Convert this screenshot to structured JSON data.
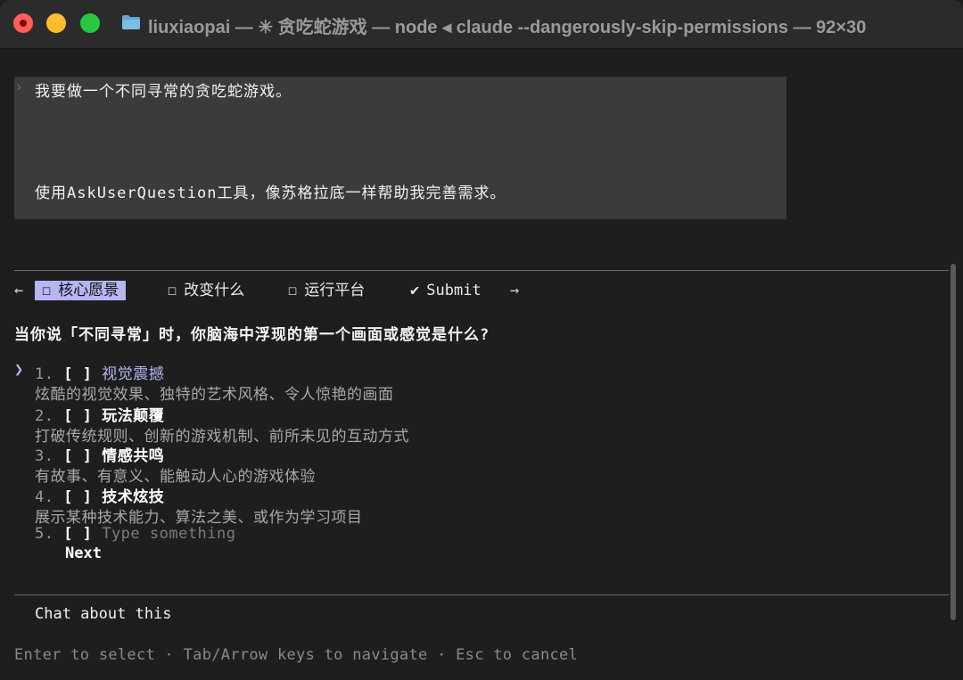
{
  "window": {
    "title": "liuxiaopai — ✳ 贪吃蛇游戏 — node ◂ claude --dangerously-skip-permissions — 92×30"
  },
  "prompt": {
    "chevron": "›",
    "line1": "我要做一个不同寻常的贪吃蛇游戏。",
    "line2": "使用AskUserQuestion工具，像苏格拉底一样帮助我完善需求。"
  },
  "tabs": {
    "left_arrow": "←",
    "right_arrow": "→",
    "items": [
      {
        "glyph": "☐",
        "label": "核心愿景",
        "active": true
      },
      {
        "glyph": "☐",
        "label": "改变什么",
        "active": false
      },
      {
        "glyph": "☐",
        "label": "运行平台",
        "active": false
      },
      {
        "glyph": "✔",
        "label": "Submit",
        "active": false
      }
    ]
  },
  "question": "当你说「不同寻常」时，你脑海中浮现的第一个画面或感觉是什么?",
  "cursor": "❯",
  "options": [
    {
      "num": "1.",
      "box": "[ ]",
      "label": "视觉震撼",
      "desc": "炫酷的视觉效果、独特的艺术风格、令人惊艳的画面"
    },
    {
      "num": "2.",
      "box": "[ ]",
      "label": "玩法颠覆",
      "desc": "打破传统规则、创新的游戏机制、前所未见的互动方式"
    },
    {
      "num": "3.",
      "box": "[ ]",
      "label": "情感共鸣",
      "desc": "有故事、有意义、能触动人心的游戏体验"
    },
    {
      "num": "4.",
      "box": "[ ]",
      "label": "技术炫技",
      "desc": "展示某种技术能力、算法之美、或作为学习项目"
    },
    {
      "num": "5.",
      "box": "[ ]",
      "placeholder": "Type something"
    }
  ],
  "next_label": "Next",
  "chat_label": "Chat about this",
  "hint": "Enter to select · Tab/Arrow keys to navigate · Esc to cancel",
  "colors": {
    "accent": "#b5b6f2",
    "background": "#1e1e1e",
    "prompt_bg": "#3b3b3b"
  }
}
